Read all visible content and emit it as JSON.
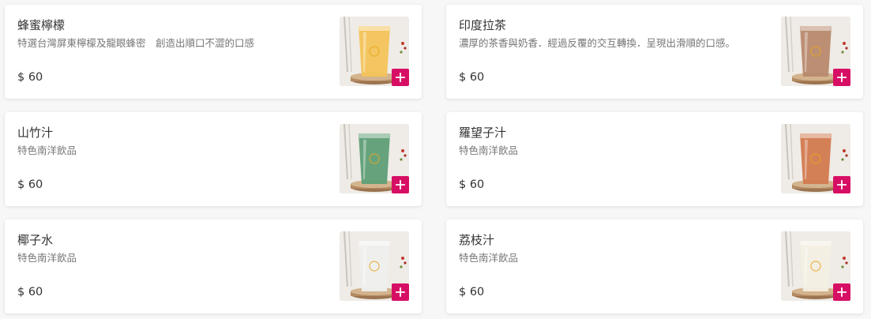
{
  "colors": {
    "accent": "#d70f64",
    "card_bg": "#ffffff",
    "page_bg": "#f7f7f7"
  },
  "items": [
    {
      "name": "蜂蜜檸檬",
      "description": "特選台灣屏東檸檬及龍眼蜂密　創造出順口不澀的口感",
      "price": "$ 60",
      "drink_color": "#f3c45a",
      "image": "honey-lemon-drink-image"
    },
    {
      "name": "印度拉茶",
      "description": "濃厚的茶香與奶香．經過反覆的交互轉換．呈現出滑順的口感。",
      "price": "$ 60",
      "drink_color": "#b88a6e",
      "image": "masala-chai-drink-image"
    },
    {
      "name": "山竹汁",
      "description": "特色南洋飲品",
      "price": "$ 60",
      "drink_color": "#5e9f77",
      "image": "mangosteen-juice-image"
    },
    {
      "name": "羅望子汁",
      "description": "特色南洋飲品",
      "price": "$ 60",
      "drink_color": "#d27a4f",
      "image": "tamarind-juice-image"
    },
    {
      "name": "椰子水",
      "description": "特色南洋飲品",
      "price": "$ 60",
      "drink_color": "#eef0ee",
      "image": "coconut-water-image"
    },
    {
      "name": "荔枝汁",
      "description": "特色南洋飲品",
      "price": "$ 60",
      "drink_color": "#f2efe3",
      "image": "lychee-juice-image"
    }
  ]
}
